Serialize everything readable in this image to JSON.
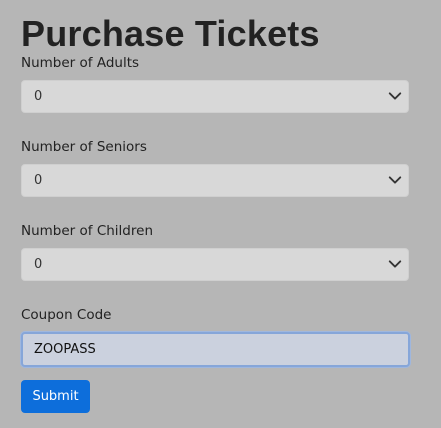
{
  "page": {
    "title": "Purchase Tickets"
  },
  "form": {
    "adults": {
      "label": "Number of Adults",
      "selected": "0"
    },
    "seniors": {
      "label": "Number of Seniors",
      "selected": "0"
    },
    "children": {
      "label": "Number of Children",
      "selected": "0"
    },
    "coupon": {
      "label": "Coupon Code",
      "value": "ZOOPASS"
    },
    "submit_label": "Submit"
  },
  "icons": {
    "select_indicator": "chevron-down-icon"
  },
  "colors": {
    "background": "#b6b6b6",
    "submit_button": "#0d6edb",
    "focus_border": "#86a6d9"
  }
}
